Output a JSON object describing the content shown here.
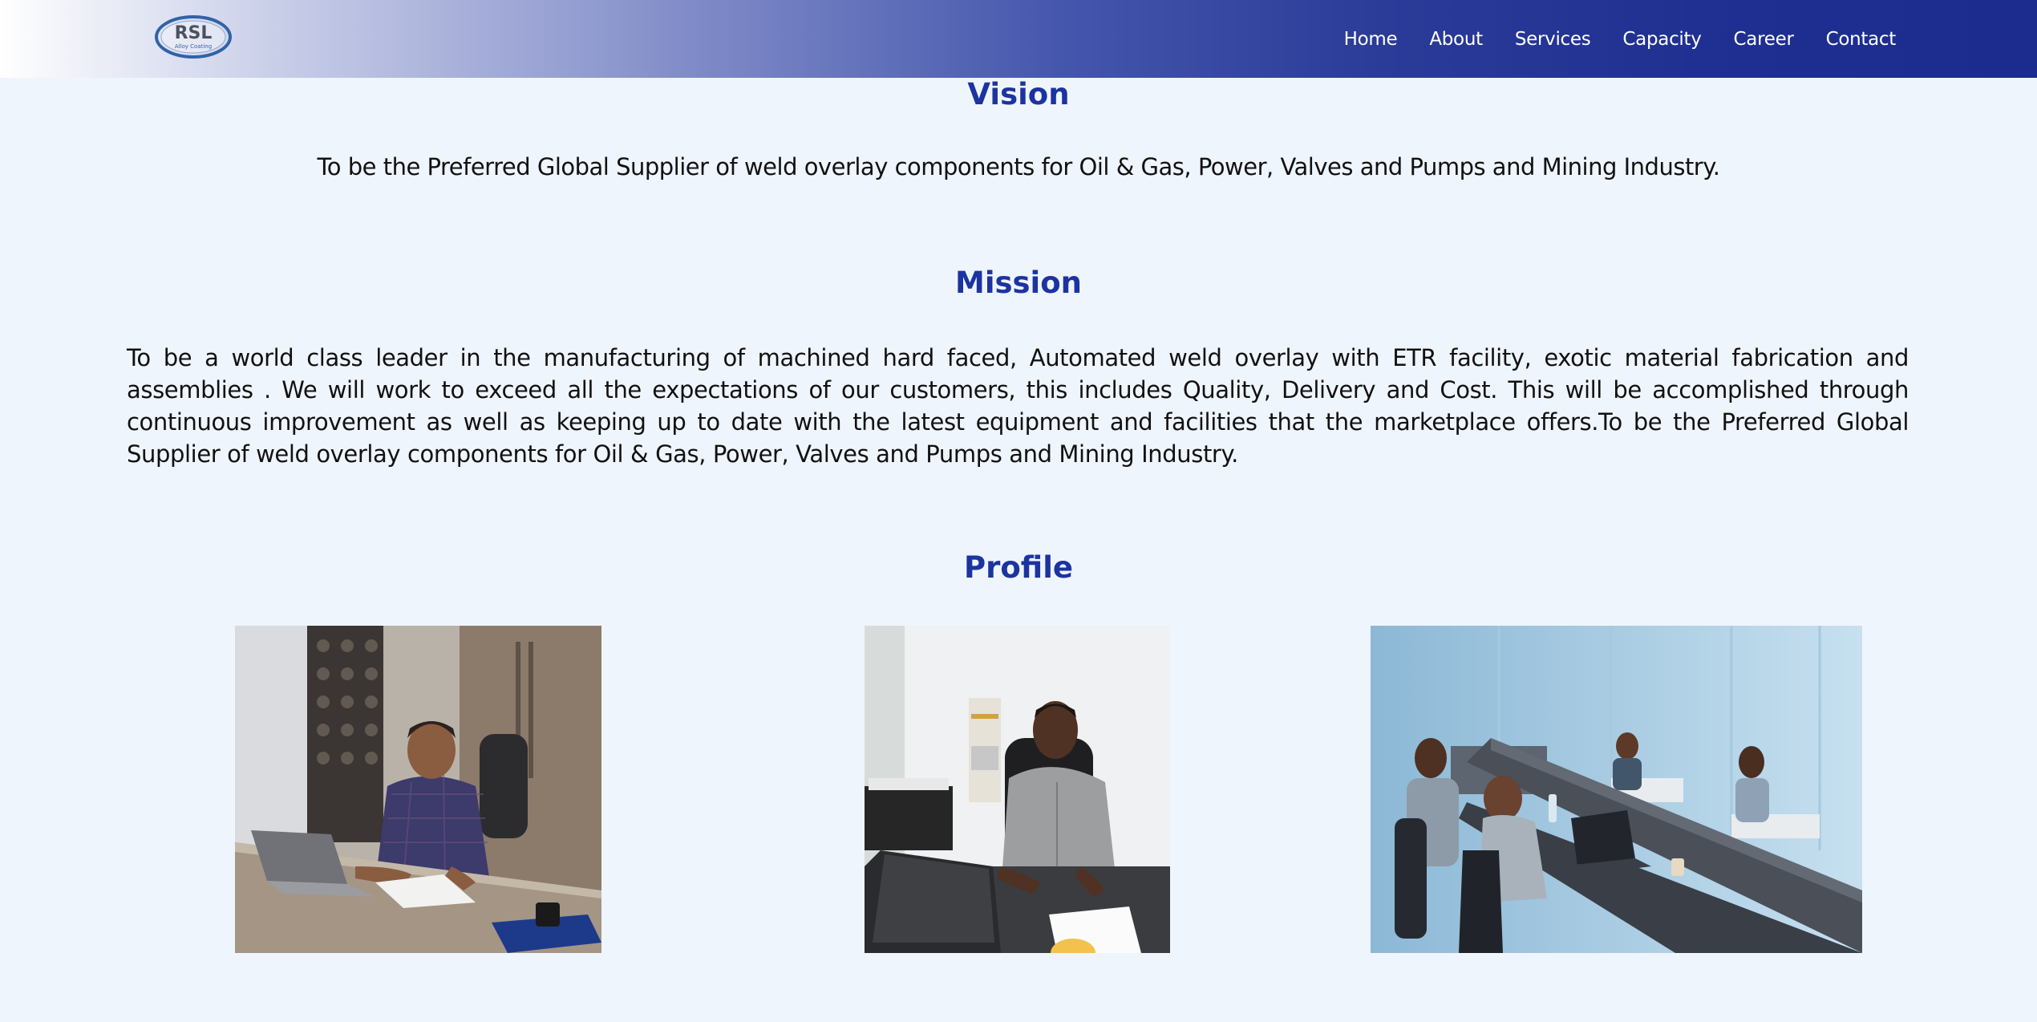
{
  "header": {
    "logo": {
      "text": "RSL",
      "subtext": "Alloy Coating"
    },
    "nav": [
      {
        "label": "Home"
      },
      {
        "label": "About"
      },
      {
        "label": "Services"
      },
      {
        "label": "Capacity"
      },
      {
        "label": "Career"
      },
      {
        "label": "Contact"
      }
    ]
  },
  "vision": {
    "title": "Vision",
    "text": "To be the Preferred Global Supplier of weld overlay components for Oil & Gas, Power, Valves and Pumps and Mining Industry."
  },
  "mission": {
    "title": "Mission",
    "text": "To be a world class leader in the manufacturing of machined hard faced, Automated weld overlay with ETR facility, exotic material fabrication and assemblies . We will work to exceed all the expectations of our customers, this includes Quality, Delivery and Cost. This will be accomplished through continuous improvement as well as keeping up to date with the latest equipment and facilities that the marketplace offers.To be the Preferred Global Supplier of weld overlay components for Oil & Gas, Power, Valves and Pumps and Mining Industry."
  },
  "profile": {
    "title": "Profile"
  },
  "colors": {
    "title": "#1c34a0",
    "header_dark": "#1b2c8e",
    "background": "#eff5fd"
  }
}
